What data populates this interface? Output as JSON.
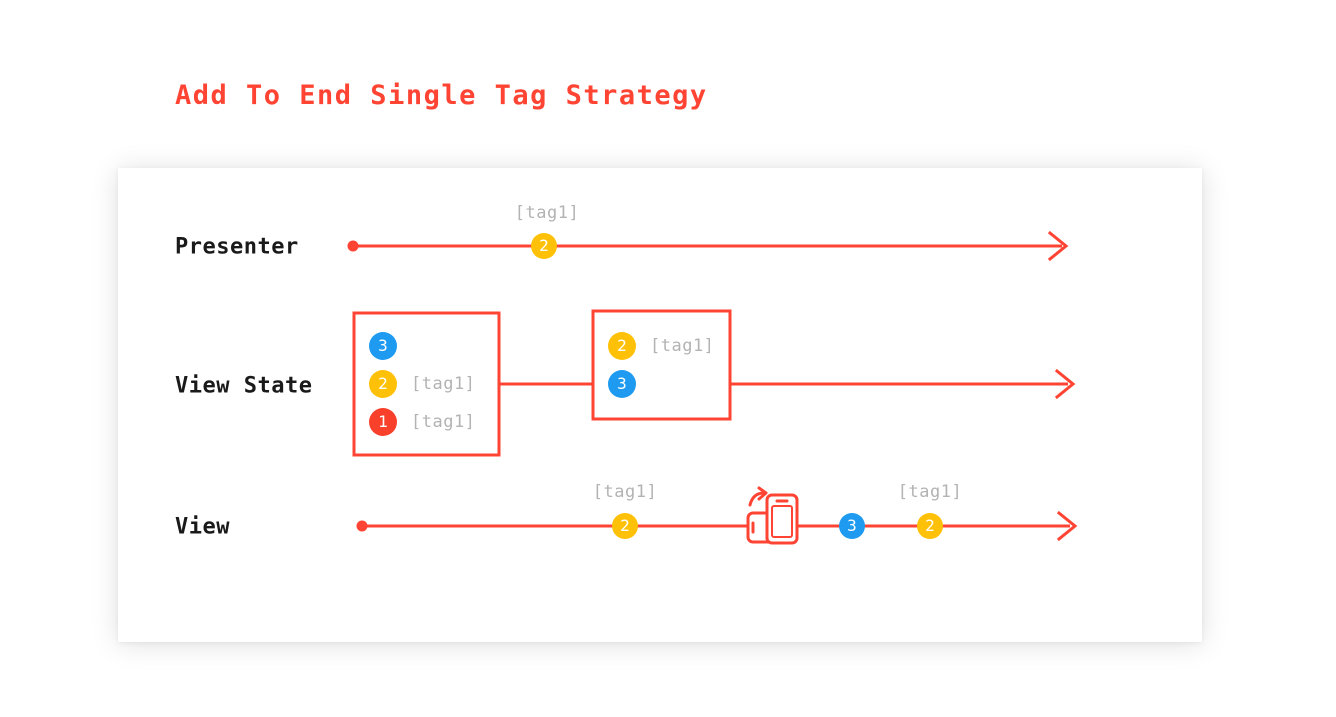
{
  "title": "Add To End Single Tag Strategy",
  "colors": {
    "accent_red": "#FF4433",
    "circle_blue": "#1E9BF0",
    "circle_yellow": "#FFC107",
    "circle_red": "#F8402B",
    "tag_gray": "#b3b3b3",
    "label_black": "#1a1a1a",
    "card_background": "#ffffff"
  },
  "lanes": {
    "presenter": {
      "label": "Presenter",
      "events": [
        {
          "value": "2",
          "color": "yellow",
          "tag": "[tag1]"
        }
      ]
    },
    "view_state": {
      "label": "View State",
      "boxes": [
        {
          "items": [
            {
              "value": "3",
              "color": "blue",
              "tag": ""
            },
            {
              "value": "2",
              "color": "yellow",
              "tag": "[tag1]"
            },
            {
              "value": "1",
              "color": "red",
              "tag": "[tag1]"
            }
          ]
        },
        {
          "items": [
            {
              "value": "2",
              "color": "yellow",
              "tag": "[tag1]"
            },
            {
              "value": "3",
              "color": "blue",
              "tag": ""
            }
          ]
        }
      ]
    },
    "view": {
      "label": "View",
      "events": [
        {
          "value": "2",
          "color": "yellow",
          "tag": "[tag1]"
        },
        {
          "value": "3",
          "color": "blue",
          "tag": ""
        },
        {
          "value": "2",
          "color": "yellow",
          "tag": "[tag1]"
        }
      ],
      "icon": "device-rotation-icon"
    }
  }
}
